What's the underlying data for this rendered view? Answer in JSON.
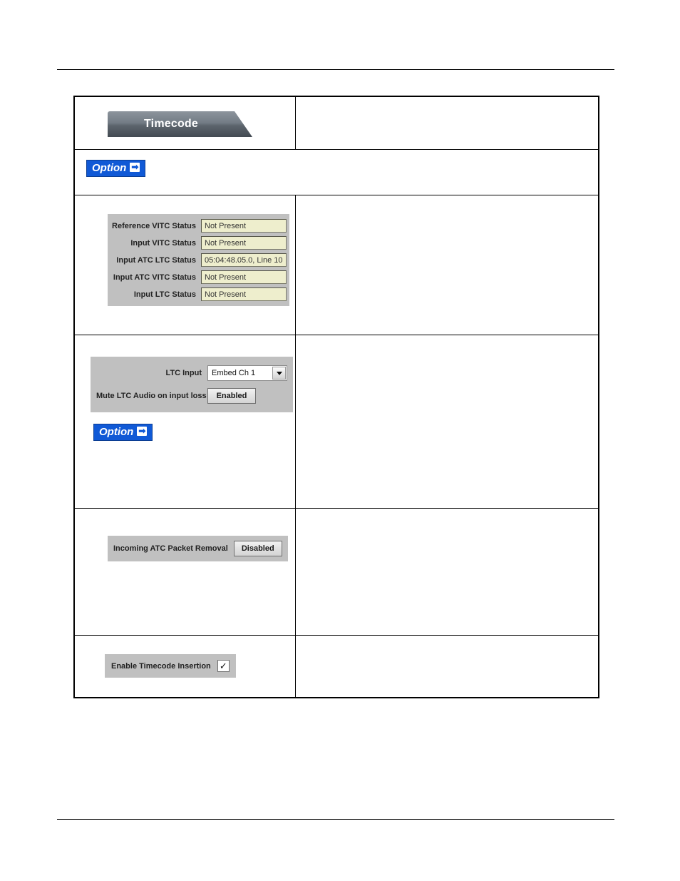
{
  "page": {
    "rules": [
      "header-rule",
      "footer-rule"
    ]
  },
  "table": {
    "rows": [
      {
        "name": "timecode-tab-row",
        "tab_label": "Timecode"
      },
      {
        "name": "option-row",
        "option_label": "Option",
        "option_arrow": "➡"
      },
      {
        "name": "status-row",
        "fields": [
          {
            "label": "Reference VITC Status",
            "value": "Not Present"
          },
          {
            "label": "Input VITC Status",
            "value": "Not Present"
          },
          {
            "label": "Input ATC LTC Status",
            "value": "05:04:48.05.0, Line 10"
          },
          {
            "label": "Input ATC VITC Status",
            "value": "Not Present"
          },
          {
            "label": "Input LTC Status",
            "value": "Not Present"
          }
        ]
      },
      {
        "name": "ltc-input-row",
        "ltc_input_label": "LTC Input",
        "ltc_input_value": "Embed Ch 1",
        "mute_label": "Mute LTC Audio on input loss",
        "mute_value": "Enabled",
        "option_label": "Option",
        "option_arrow": "➡"
      },
      {
        "name": "atc-removal-row",
        "atc_label": "Incoming ATC Packet Removal",
        "atc_value": "Disabled"
      },
      {
        "name": "timecode-insertion-row",
        "insertion_label": "Enable Timecode Insertion",
        "checkbox_glyph": "✓"
      }
    ]
  }
}
